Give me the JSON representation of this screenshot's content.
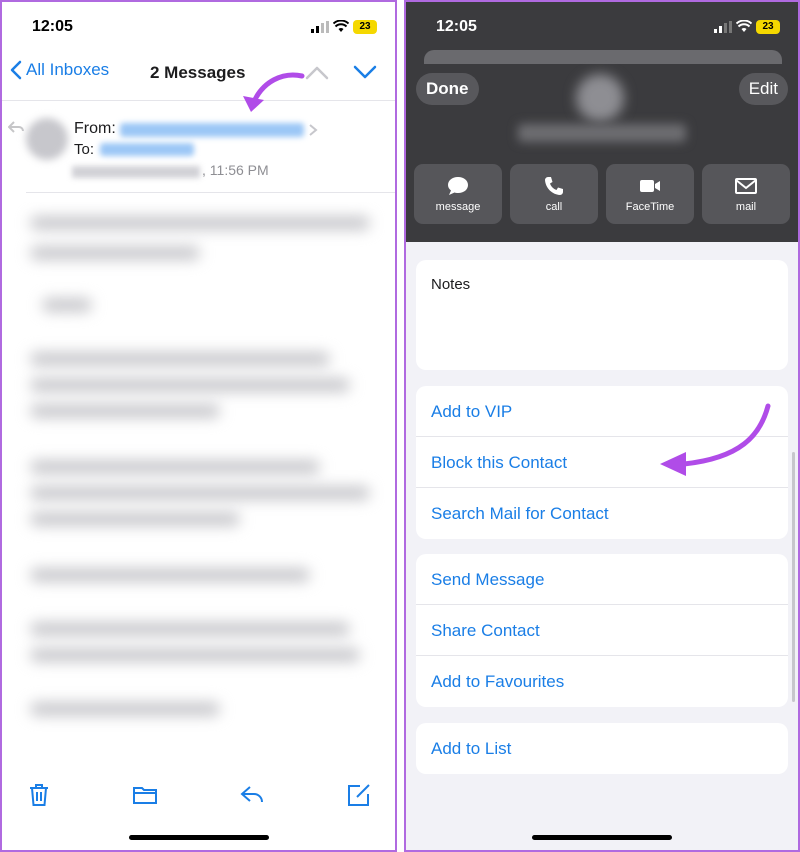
{
  "left": {
    "status": {
      "time": "12:05",
      "battery": "23"
    },
    "nav": {
      "back_label": "All Inboxes",
      "title": "2 Messages"
    },
    "header": {
      "from_label": "From:",
      "to_label": "To:",
      "time": ", 11:56 PM"
    },
    "toolbar": {
      "icons": [
        "trash-icon",
        "folder-icon",
        "reply-icon",
        "compose-icon"
      ]
    }
  },
  "right": {
    "status": {
      "time": "12:05",
      "battery": "23"
    },
    "top_buttons": {
      "done": "Done",
      "edit": "Edit"
    },
    "actions": [
      {
        "label": "message",
        "icon": "message-bubble-icon"
      },
      {
        "label": "call",
        "icon": "phone-icon"
      },
      {
        "label": "FaceTime",
        "icon": "video-camera-icon"
      },
      {
        "label": "mail",
        "icon": "envelope-icon"
      }
    ],
    "notes_label": "Notes",
    "group1": [
      "Add to VIP",
      "Block this Contact",
      "Search Mail for Contact"
    ],
    "group2": [
      "Send Message",
      "Share Contact",
      "Add to Favourites"
    ],
    "group3": [
      "Add to List"
    ]
  },
  "colors": {
    "accent": "#1a7ee6",
    "annotation": "#b04ce8",
    "border": "#b06ae0"
  }
}
